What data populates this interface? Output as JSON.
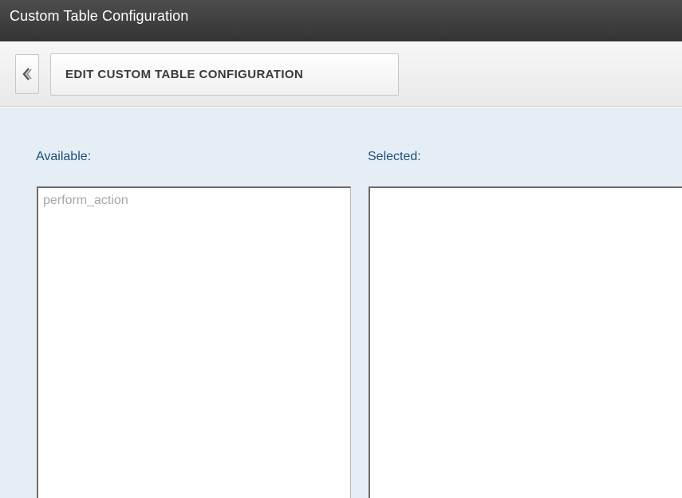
{
  "window": {
    "title": "Custom Table Configuration"
  },
  "toolbar": {
    "back_icon": "chevron-left-icon",
    "edit_button_label": "EDIT CUSTOM TABLE CONFIGURATION"
  },
  "available": {
    "label": "Available:",
    "items": [
      "perform_action"
    ]
  },
  "selected": {
    "label": "Selected:",
    "items": []
  },
  "colors": {
    "titlebar": "#3e3e3e",
    "content_background": "#e5eef5",
    "label_text": "#1f4e79",
    "item_text": "#a7a7a7"
  }
}
